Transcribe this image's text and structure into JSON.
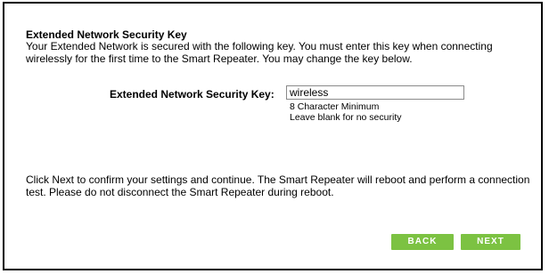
{
  "section": {
    "title": "Extended Network Security Key",
    "description": "Your Extended Network is secured with the following key. You must enter this key when connecting wirelessly for the first time to the Smart Repeater. You may change the key below."
  },
  "security_key": {
    "label": "Extended Network Security Key:",
    "value": "wireless",
    "hint_min": "8 Character Minimum",
    "hint_blank": "Leave blank for no security"
  },
  "confirm_text": "Click Next to confirm your settings and continue. The Smart Repeater will reboot and perform a connection test. Please do not disconnect the Smart Repeater during reboot.",
  "buttons": {
    "back_label": "BACK",
    "next_label": "NEXT"
  },
  "colors": {
    "button_green": "#7cc242",
    "border": "#000000",
    "input_border": "#8a8a8a"
  }
}
